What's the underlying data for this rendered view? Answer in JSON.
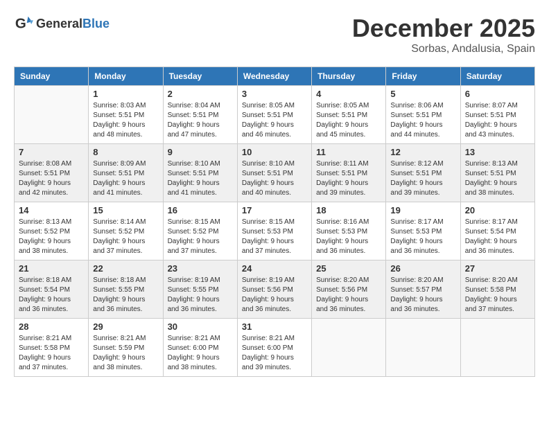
{
  "header": {
    "logo_general": "General",
    "logo_blue": "Blue",
    "month": "December 2025",
    "location": "Sorbas, Andalusia, Spain"
  },
  "days_of_week": [
    "Sunday",
    "Monday",
    "Tuesday",
    "Wednesday",
    "Thursday",
    "Friday",
    "Saturday"
  ],
  "weeks": [
    [
      {
        "day": "",
        "sunrise": "",
        "sunset": "",
        "daylight": ""
      },
      {
        "day": "1",
        "sunrise": "Sunrise: 8:03 AM",
        "sunset": "Sunset: 5:51 PM",
        "daylight": "Daylight: 9 hours and 48 minutes."
      },
      {
        "day": "2",
        "sunrise": "Sunrise: 8:04 AM",
        "sunset": "Sunset: 5:51 PM",
        "daylight": "Daylight: 9 hours and 47 minutes."
      },
      {
        "day": "3",
        "sunrise": "Sunrise: 8:05 AM",
        "sunset": "Sunset: 5:51 PM",
        "daylight": "Daylight: 9 hours and 46 minutes."
      },
      {
        "day": "4",
        "sunrise": "Sunrise: 8:05 AM",
        "sunset": "Sunset: 5:51 PM",
        "daylight": "Daylight: 9 hours and 45 minutes."
      },
      {
        "day": "5",
        "sunrise": "Sunrise: 8:06 AM",
        "sunset": "Sunset: 5:51 PM",
        "daylight": "Daylight: 9 hours and 44 minutes."
      },
      {
        "day": "6",
        "sunrise": "Sunrise: 8:07 AM",
        "sunset": "Sunset: 5:51 PM",
        "daylight": "Daylight: 9 hours and 43 minutes."
      }
    ],
    [
      {
        "day": "7",
        "sunrise": "Sunrise: 8:08 AM",
        "sunset": "Sunset: 5:51 PM",
        "daylight": "Daylight: 9 hours and 42 minutes."
      },
      {
        "day": "8",
        "sunrise": "Sunrise: 8:09 AM",
        "sunset": "Sunset: 5:51 PM",
        "daylight": "Daylight: 9 hours and 41 minutes."
      },
      {
        "day": "9",
        "sunrise": "Sunrise: 8:10 AM",
        "sunset": "Sunset: 5:51 PM",
        "daylight": "Daylight: 9 hours and 41 minutes."
      },
      {
        "day": "10",
        "sunrise": "Sunrise: 8:10 AM",
        "sunset": "Sunset: 5:51 PM",
        "daylight": "Daylight: 9 hours and 40 minutes."
      },
      {
        "day": "11",
        "sunrise": "Sunrise: 8:11 AM",
        "sunset": "Sunset: 5:51 PM",
        "daylight": "Daylight: 9 hours and 39 minutes."
      },
      {
        "day": "12",
        "sunrise": "Sunrise: 8:12 AM",
        "sunset": "Sunset: 5:51 PM",
        "daylight": "Daylight: 9 hours and 39 minutes."
      },
      {
        "day": "13",
        "sunrise": "Sunrise: 8:13 AM",
        "sunset": "Sunset: 5:51 PM",
        "daylight": "Daylight: 9 hours and 38 minutes."
      }
    ],
    [
      {
        "day": "14",
        "sunrise": "Sunrise: 8:13 AM",
        "sunset": "Sunset: 5:52 PM",
        "daylight": "Daylight: 9 hours and 38 minutes."
      },
      {
        "day": "15",
        "sunrise": "Sunrise: 8:14 AM",
        "sunset": "Sunset: 5:52 PM",
        "daylight": "Daylight: 9 hours and 37 minutes."
      },
      {
        "day": "16",
        "sunrise": "Sunrise: 8:15 AM",
        "sunset": "Sunset: 5:52 PM",
        "daylight": "Daylight: 9 hours and 37 minutes."
      },
      {
        "day": "17",
        "sunrise": "Sunrise: 8:15 AM",
        "sunset": "Sunset: 5:53 PM",
        "daylight": "Daylight: 9 hours and 37 minutes."
      },
      {
        "day": "18",
        "sunrise": "Sunrise: 8:16 AM",
        "sunset": "Sunset: 5:53 PM",
        "daylight": "Daylight: 9 hours and 36 minutes."
      },
      {
        "day": "19",
        "sunrise": "Sunrise: 8:17 AM",
        "sunset": "Sunset: 5:53 PM",
        "daylight": "Daylight: 9 hours and 36 minutes."
      },
      {
        "day": "20",
        "sunrise": "Sunrise: 8:17 AM",
        "sunset": "Sunset: 5:54 PM",
        "daylight": "Daylight: 9 hours and 36 minutes."
      }
    ],
    [
      {
        "day": "21",
        "sunrise": "Sunrise: 8:18 AM",
        "sunset": "Sunset: 5:54 PM",
        "daylight": "Daylight: 9 hours and 36 minutes."
      },
      {
        "day": "22",
        "sunrise": "Sunrise: 8:18 AM",
        "sunset": "Sunset: 5:55 PM",
        "daylight": "Daylight: 9 hours and 36 minutes."
      },
      {
        "day": "23",
        "sunrise": "Sunrise: 8:19 AM",
        "sunset": "Sunset: 5:55 PM",
        "daylight": "Daylight: 9 hours and 36 minutes."
      },
      {
        "day": "24",
        "sunrise": "Sunrise: 8:19 AM",
        "sunset": "Sunset: 5:56 PM",
        "daylight": "Daylight: 9 hours and 36 minutes."
      },
      {
        "day": "25",
        "sunrise": "Sunrise: 8:20 AM",
        "sunset": "Sunset: 5:56 PM",
        "daylight": "Daylight: 9 hours and 36 minutes."
      },
      {
        "day": "26",
        "sunrise": "Sunrise: 8:20 AM",
        "sunset": "Sunset: 5:57 PM",
        "daylight": "Daylight: 9 hours and 36 minutes."
      },
      {
        "day": "27",
        "sunrise": "Sunrise: 8:20 AM",
        "sunset": "Sunset: 5:58 PM",
        "daylight": "Daylight: 9 hours and 37 minutes."
      }
    ],
    [
      {
        "day": "28",
        "sunrise": "Sunrise: 8:21 AM",
        "sunset": "Sunset: 5:58 PM",
        "daylight": "Daylight: 9 hours and 37 minutes."
      },
      {
        "day": "29",
        "sunrise": "Sunrise: 8:21 AM",
        "sunset": "Sunset: 5:59 PM",
        "daylight": "Daylight: 9 hours and 38 minutes."
      },
      {
        "day": "30",
        "sunrise": "Sunrise: 8:21 AM",
        "sunset": "Sunset: 6:00 PM",
        "daylight": "Daylight: 9 hours and 38 minutes."
      },
      {
        "day": "31",
        "sunrise": "Sunrise: 8:21 AM",
        "sunset": "Sunset: 6:00 PM",
        "daylight": "Daylight: 9 hours and 39 minutes."
      },
      {
        "day": "",
        "sunrise": "",
        "sunset": "",
        "daylight": ""
      },
      {
        "day": "",
        "sunrise": "",
        "sunset": "",
        "daylight": ""
      },
      {
        "day": "",
        "sunrise": "",
        "sunset": "",
        "daylight": ""
      }
    ]
  ]
}
